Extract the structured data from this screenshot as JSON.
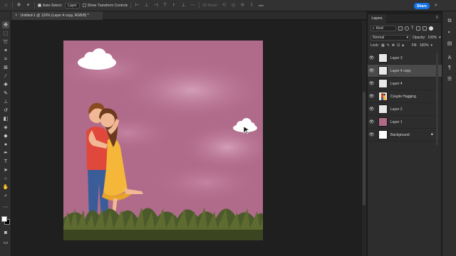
{
  "options_bar": {
    "auto_select_label": "Auto-Select:",
    "auto_select_target": "Layer",
    "show_transform_label": "Show Transform Controls",
    "mode_3d_label": "3D Mode:",
    "share_label": "Share"
  },
  "document": {
    "tab_title": "Untitled-1 @ 126% (Layer 4 copy, RGB/8) *"
  },
  "layers_panel": {
    "tab_label": "Layers",
    "filter_kind": "Kind",
    "blend_mode": "Normal",
    "opacity_label": "Opacity:",
    "opacity_value": "100%",
    "lock_label": "Lock:",
    "fill_label": "Fill:",
    "fill_value": "100%",
    "layers": [
      {
        "name": "Layer 3",
        "thumb": "#e8e8e8",
        "selected": false
      },
      {
        "name": "Layer 4 copy",
        "thumb": "#e8e8e8",
        "selected": true
      },
      {
        "name": "Layer 4",
        "thumb": "#e8e8e8",
        "selected": false
      },
      {
        "name": "Couple Hugging",
        "thumb": "#f2ece6",
        "selected": false
      },
      {
        "name": "Layer 2",
        "thumb": "#e8e8e8",
        "selected": false
      },
      {
        "name": "Layer 1",
        "thumb": "#b06a8a",
        "selected": false
      },
      {
        "name": "Background",
        "thumb": "#ffffff",
        "selected": false,
        "locked": true
      }
    ]
  },
  "colors": {
    "canvas_bg": "#b06a8a",
    "accent": "#1473e6",
    "foreground": "#ffffff",
    "background": "#000000"
  }
}
